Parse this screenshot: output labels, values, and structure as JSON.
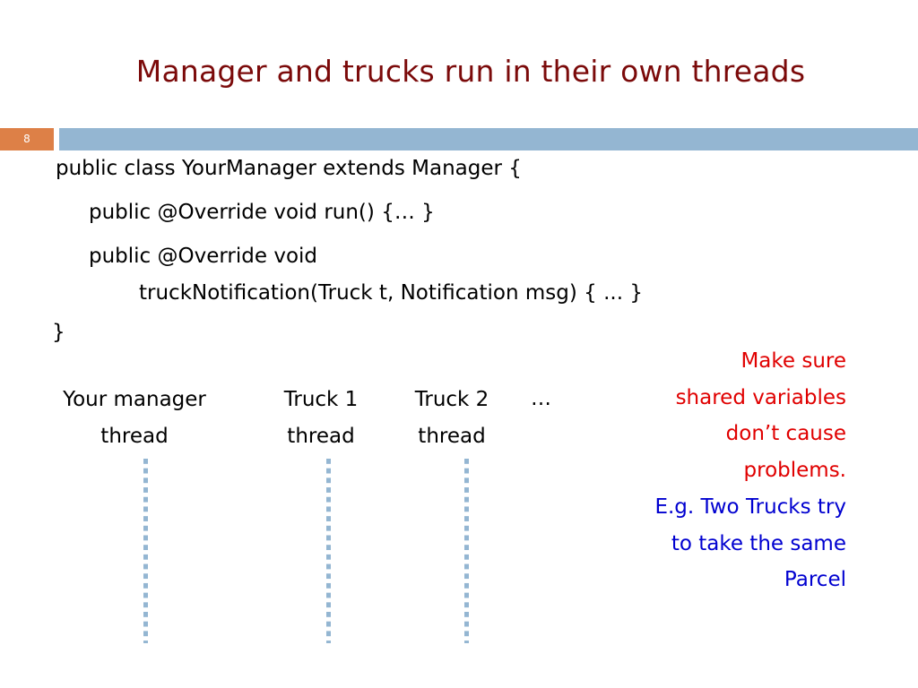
{
  "slide": {
    "title": "Manager and trucks run in their own threads",
    "number": "8",
    "colors": {
      "title": "#7b0a0a",
      "number_box": "#dd8047",
      "header_bar": "#94b6d2",
      "note_warning": "#e00000",
      "note_example": "#0000d0",
      "thread_line": "#94b6d2"
    }
  },
  "code": {
    "lines": [
      "public class YourManager extends Manager {",
      "public @Override void run() {… }",
      "public @Override void",
      "truckNotification(Truck t, Notification msg) { ... }",
      "}"
    ]
  },
  "threads": [
    {
      "line1": "Your manager",
      "line2": "thread"
    },
    {
      "line1": "Truck 1",
      "line2": "thread"
    },
    {
      "line1": "Truck 2",
      "line2": "thread"
    }
  ],
  "threads_ellipsis": "…",
  "notes": {
    "warning": [
      "Make sure",
      "shared variables",
      "don’t cause",
      "problems."
    ],
    "example": [
      "E.g. Two Trucks try",
      "to take the same",
      "Parcel"
    ]
  }
}
